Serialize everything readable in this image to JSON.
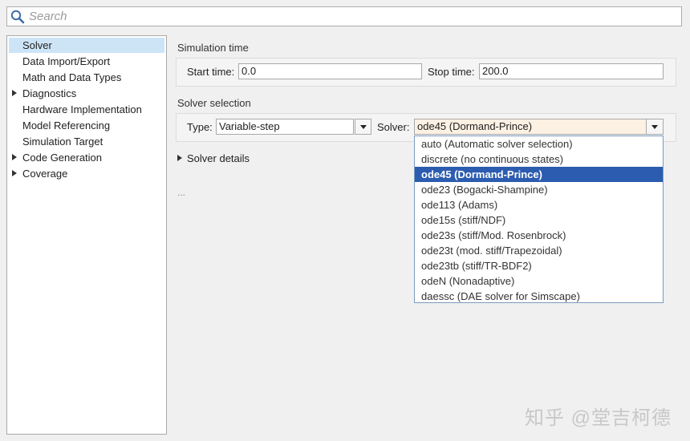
{
  "search": {
    "placeholder": "Search"
  },
  "tree": {
    "items": [
      {
        "label": "Solver",
        "selected": true,
        "expandable": false
      },
      {
        "label": "Data Import/Export",
        "expandable": false
      },
      {
        "label": "Math and Data Types",
        "expandable": false
      },
      {
        "label": "Diagnostics",
        "expandable": true
      },
      {
        "label": "Hardware Implementation",
        "expandable": false
      },
      {
        "label": "Model Referencing",
        "expandable": false
      },
      {
        "label": "Simulation Target",
        "expandable": false
      },
      {
        "label": "Code Generation",
        "expandable": true
      },
      {
        "label": "Coverage",
        "expandable": true
      }
    ]
  },
  "simulation_time": {
    "title": "Simulation time",
    "start_label": "Start time:",
    "start_value": "0.0",
    "stop_label": "Stop time:",
    "stop_value": "200.0"
  },
  "solver_selection": {
    "title": "Solver selection",
    "type_label": "Type:",
    "type_value": "Variable-step",
    "solver_label": "Solver:",
    "solver_value": "ode45 (Dormand-Prince)",
    "details_label": "Solver details",
    "ellipsis": "..."
  },
  "solver_options": [
    "auto (Automatic solver selection)",
    "discrete (no continuous states)",
    "ode45 (Dormand-Prince)",
    "ode23 (Bogacki-Shampine)",
    "ode113 (Adams)",
    "ode15s (stiff/NDF)",
    "ode23s (stiff/Mod. Rosenbrock)",
    "ode23t (mod. stiff/Trapezoidal)",
    "ode23tb (stiff/TR-BDF2)",
    "odeN (Nonadaptive)",
    "daessc (DAE solver for Simscape)"
  ],
  "selected_option_index": 2,
  "watermark": "知乎 @堂吉柯德",
  "colors": {
    "selection": "#2c5cb0",
    "tree_selection": "#cde4f7"
  }
}
